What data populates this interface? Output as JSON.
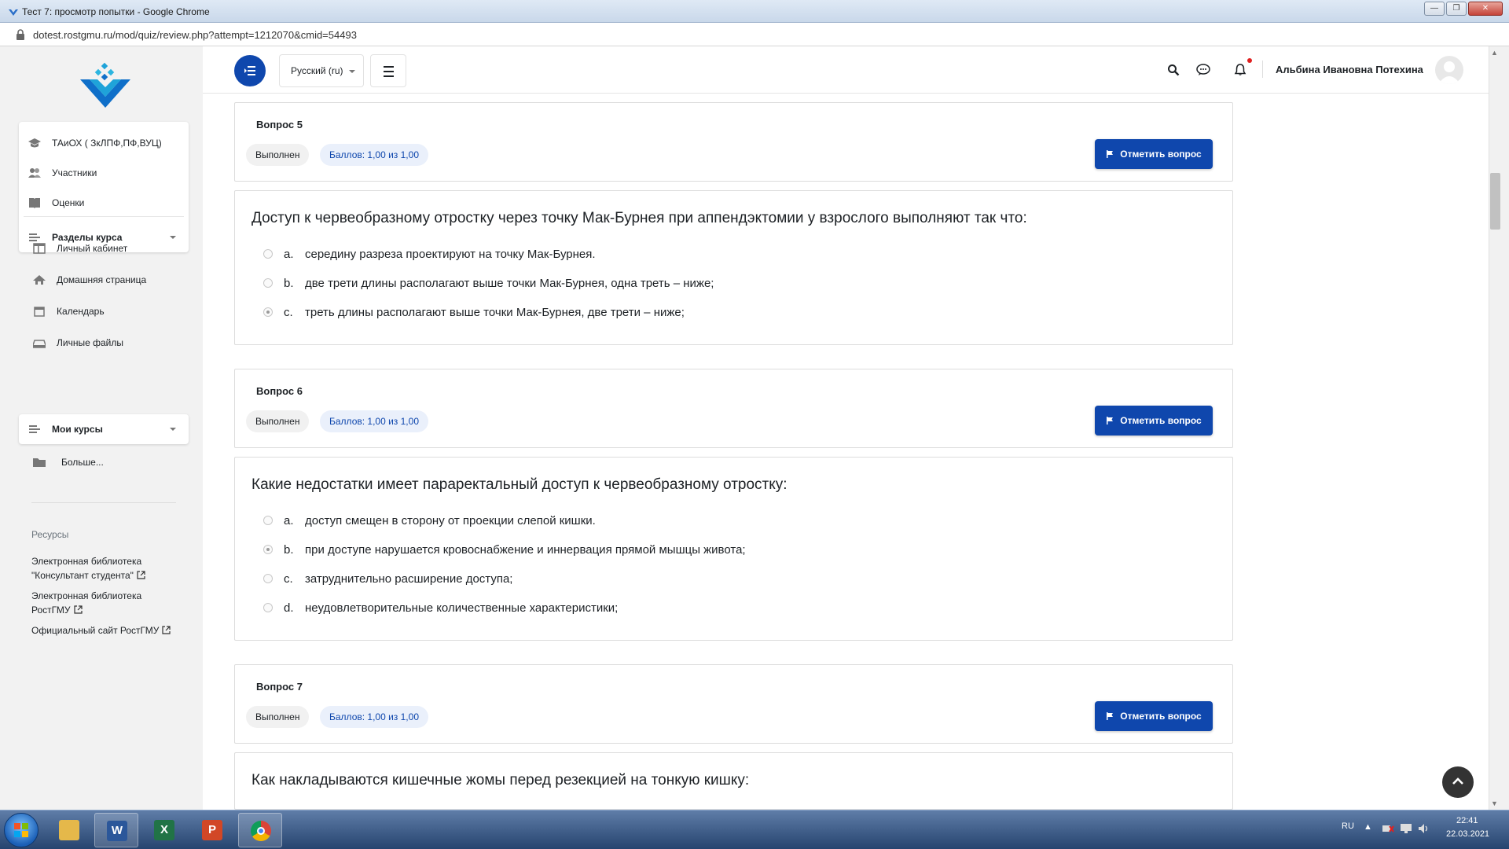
{
  "window": {
    "title": "Тест 7: просмотр попытки - Google Chrome",
    "url": "dotest.rostgmu.ru/mod/quiz/review.php?attempt=1212070&cmid=54493"
  },
  "sidebar": {
    "course_block": [
      {
        "label": "ТАиОХ ( ЗкЛПФ,ПФ,ВУЦ)",
        "icon": "graduation-cap-icon"
      },
      {
        "label": "Участники",
        "icon": "users-icon"
      },
      {
        "label": "Оценки",
        "icon": "book-icon"
      }
    ],
    "course_sections": "Разделы курса",
    "nav_items": [
      {
        "label": "Личный кабинет",
        "icon": "dashboard-icon"
      },
      {
        "label": "Домашняя страница",
        "icon": "home-icon"
      },
      {
        "label": "Календарь",
        "icon": "calendar-icon"
      },
      {
        "label": "Личные файлы",
        "icon": "files-icon"
      }
    ],
    "my_courses": "Мои курсы",
    "more": "Больше...",
    "resources_title": "Ресурсы",
    "resources": [
      {
        "line1": "Электронная библиотека",
        "line2": "\"Консультант студента\""
      },
      {
        "line1": "Электронная библиотека",
        "line2": "РостГМУ"
      },
      {
        "line1": "Официальный сайт РостГМУ",
        "line2": ""
      }
    ]
  },
  "navbar": {
    "language": "Русский (ru)",
    "user_name": "Альбина Ивановна Потехина"
  },
  "questions": [
    {
      "title": "Вопрос 5",
      "state": "Выполнен",
      "grade": "Баллов: 1,00 из 1,00",
      "flag_label": "Отметить вопрос",
      "text": "Доступ к червеобразному отростку через точку Мак-Бурнея при аппендэктомии у взрослого выполняют так что:",
      "answers": [
        {
          "letter": "a.",
          "text": "середину разреза проектируют на точку Мак-Бурнея.",
          "selected": false
        },
        {
          "letter": "b.",
          "text": "две трети длины располагают выше точки Мак-Бурнея, одна треть – ниже;",
          "selected": false
        },
        {
          "letter": "c.",
          "text": "треть длины располагают выше точки Мак-Бурнея, две трети – ниже;",
          "selected": true
        }
      ]
    },
    {
      "title": "Вопрос 6",
      "state": "Выполнен",
      "grade": "Баллов: 1,00 из 1,00",
      "flag_label": "Отметить вопрос",
      "text": "Какие недостатки имеет параректальный доступ к червеобразному отростку:",
      "answers": [
        {
          "letter": "a.",
          "text": "доступ смещен в сторону от проекции слепой кишки.",
          "selected": false
        },
        {
          "letter": "b.",
          "text": "при доступе нарушается кровоснабжение и иннервация прямой мышцы живота;",
          "selected": true
        },
        {
          "letter": "c.",
          "text": "затруднительно расширение доступа;",
          "selected": false
        },
        {
          "letter": "d.",
          "text": "неудовлетворительные количественные характеристики;",
          "selected": false
        }
      ]
    },
    {
      "title": "Вопрос 7",
      "state": "Выполнен",
      "grade": "Баллов: 1,00 из 1,00",
      "flag_label": "Отметить вопрос",
      "text": "Как накладываются кишечные жомы перед резекцией на тонкую кишку:"
    }
  ],
  "taskbar": {
    "apps": [
      "windows-explorer-icon",
      "word-icon",
      "excel-icon",
      "powerpoint-icon",
      "chrome-icon"
    ],
    "lang": "RU",
    "time": "22:41",
    "date": "22.03.2021"
  }
}
